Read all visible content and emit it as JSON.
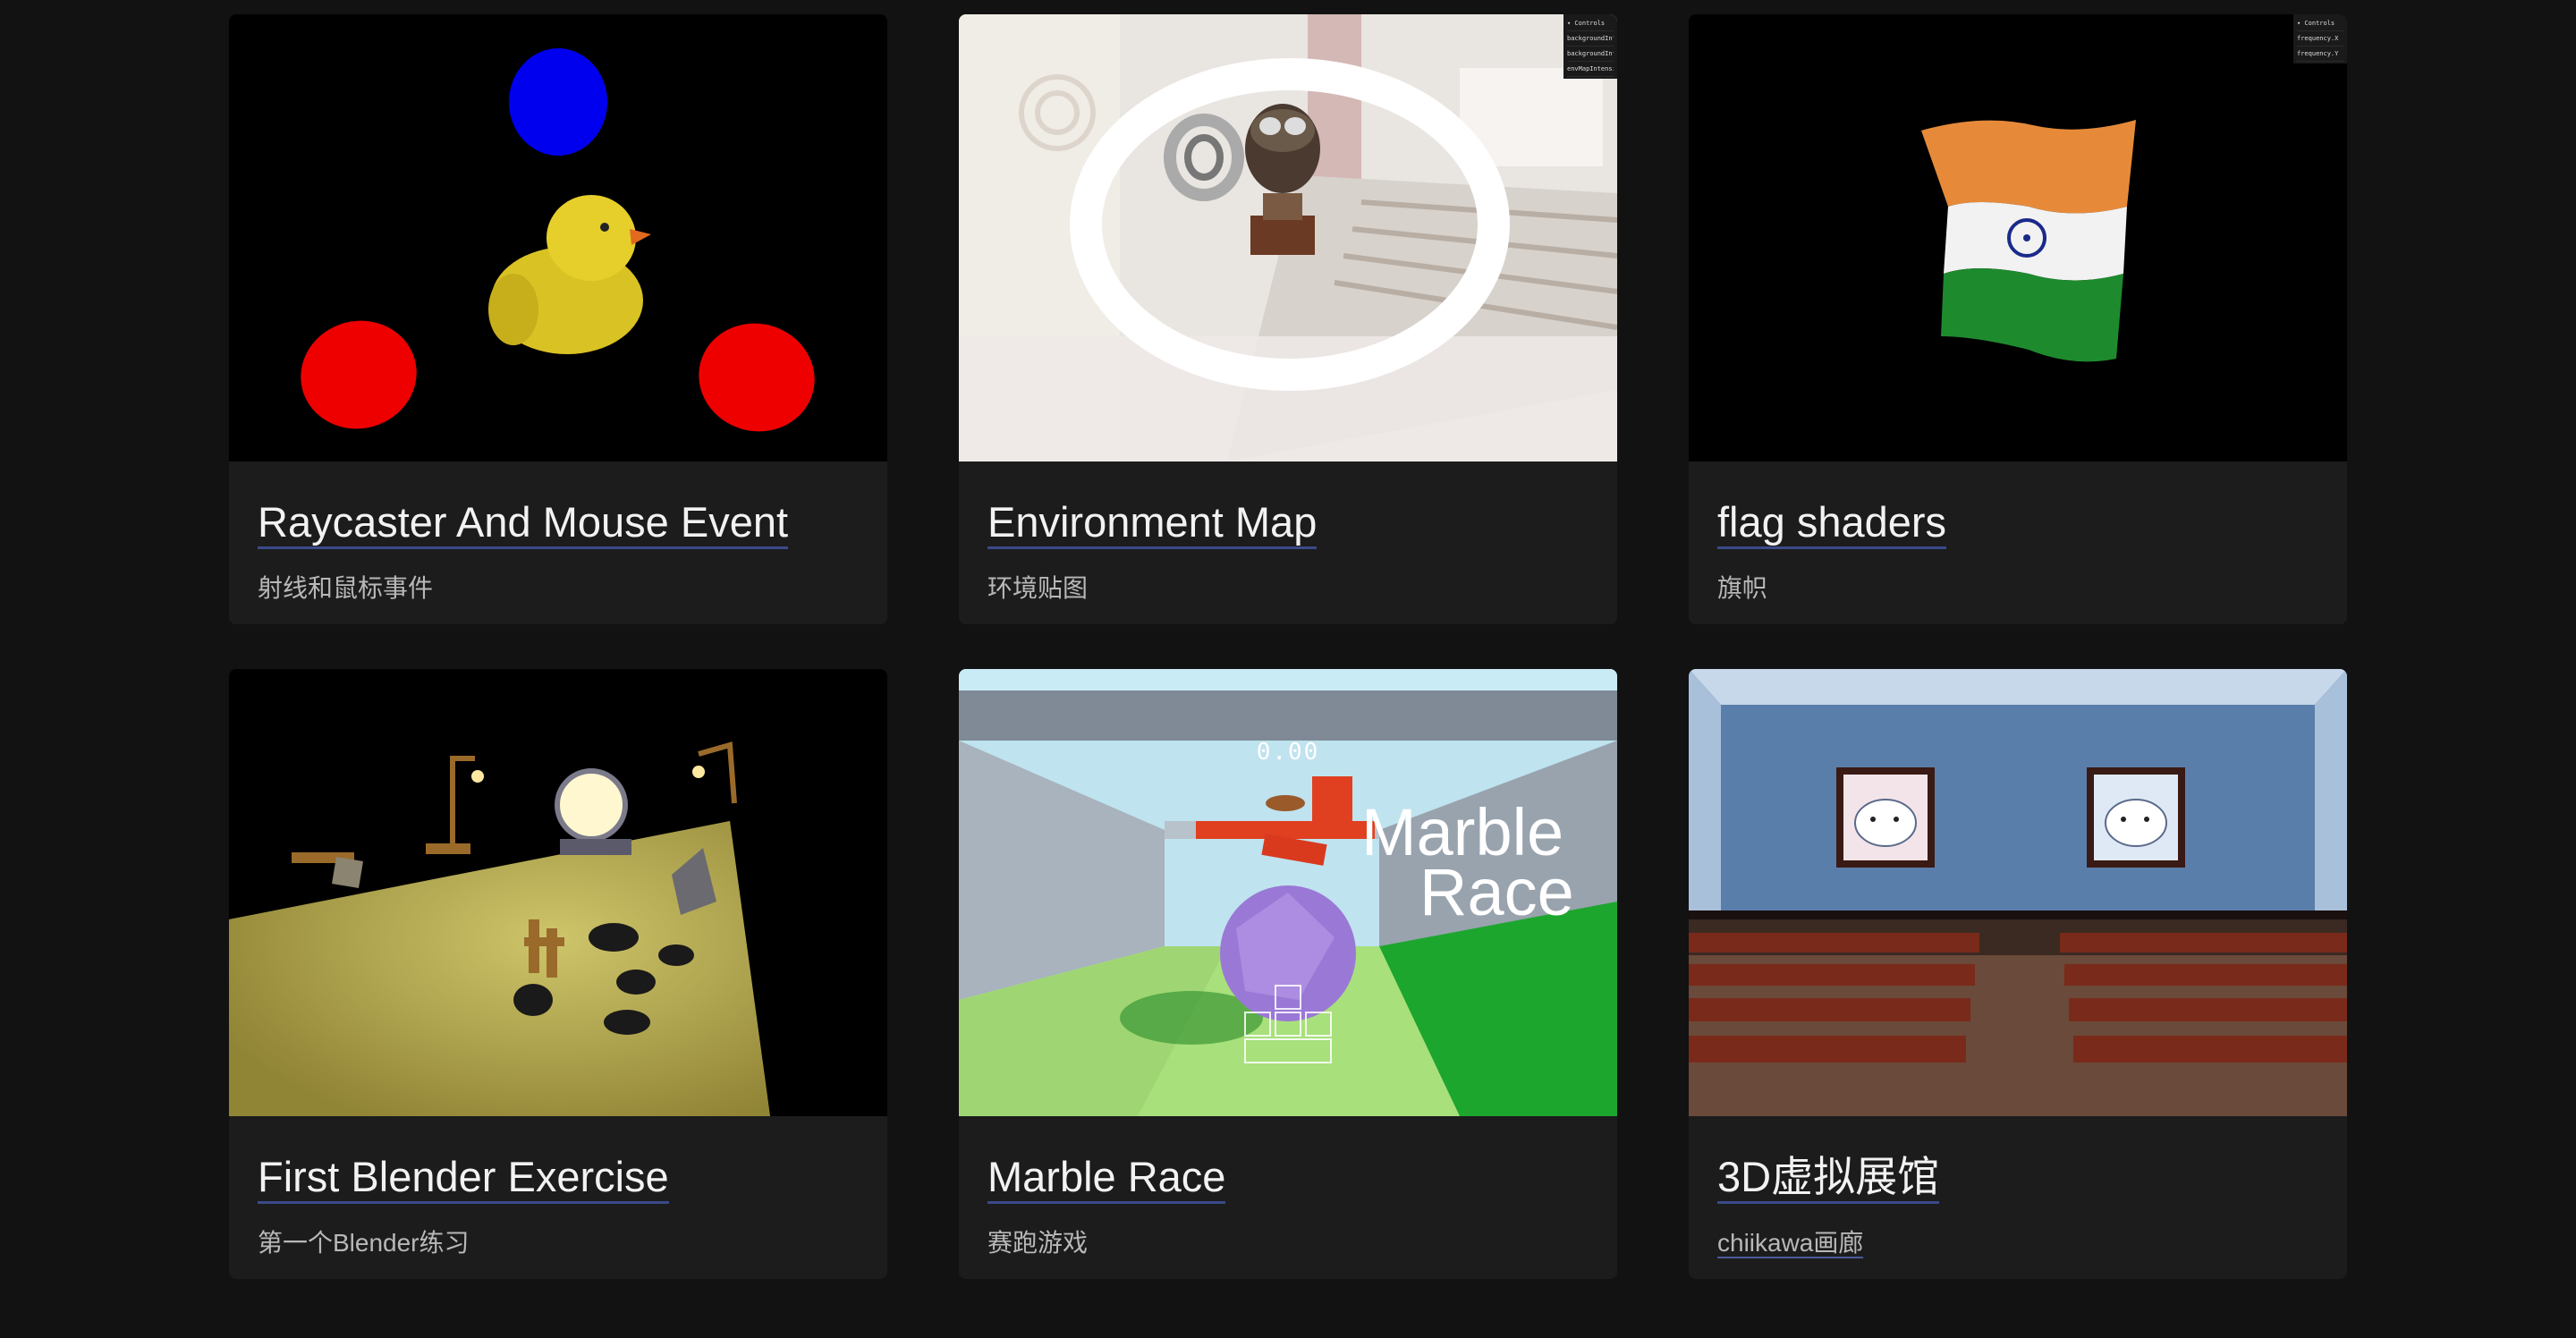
{
  "cards": [
    {
      "title": "Raycaster And Mouse Event",
      "subtitle": "射线和鼠标事件"
    },
    {
      "title": "Environment Map",
      "subtitle": "环境贴图",
      "controls": {
        "header": "▾ Controls",
        "items": [
          "backgroundIntensity",
          "backgroundIntensity",
          "envMapIntensity"
        ]
      }
    },
    {
      "title": "flag shaders",
      "subtitle": "旗帜",
      "controls": {
        "header": "▾ Controls",
        "items": [
          "frequency.X",
          "frequency.Y"
        ]
      }
    },
    {
      "title": "First Blender Exercise",
      "subtitle": "第一个Blender练习"
    },
    {
      "title": "Marble Race",
      "subtitle": "赛跑游戏",
      "timer": "0.00",
      "sign_line1": "Marble",
      "sign_line2": "Race"
    },
    {
      "title": "3D虚拟展馆",
      "subtitle": "chiikawa画廊"
    }
  ],
  "colors": {
    "page_bg": "#121212",
    "card_bg": "#1c1c1c",
    "title": "#f2f2f2",
    "subtitle": "#b8b8b8",
    "underline": "#3a4a8a"
  }
}
